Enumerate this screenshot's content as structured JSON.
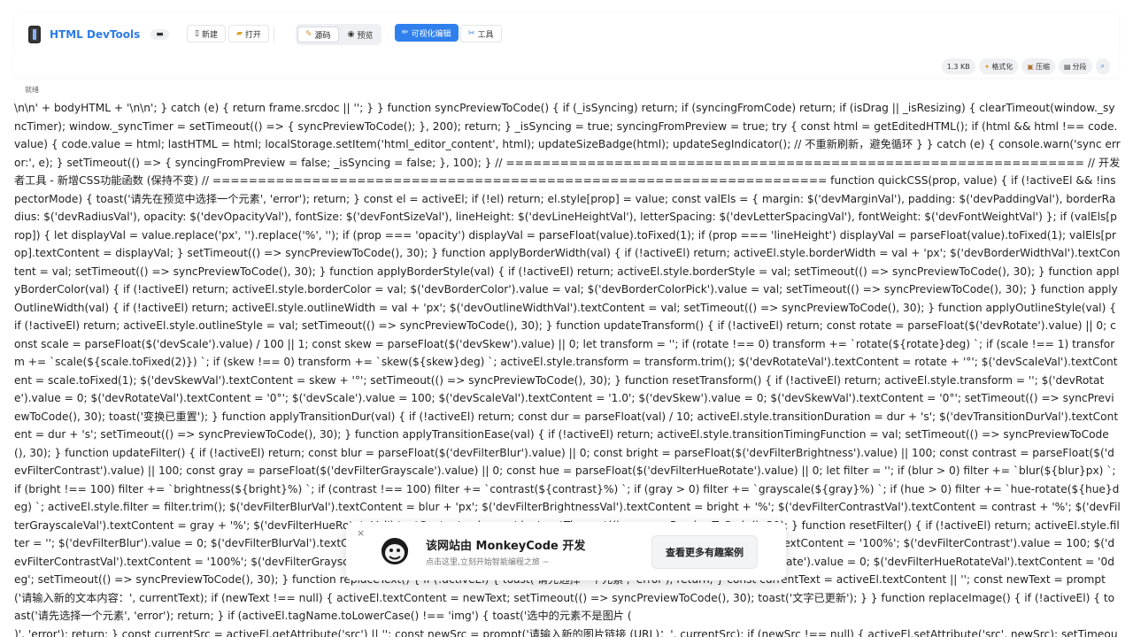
{
  "brand": {
    "title": "HTML DevTools",
    "badge": "▬"
  },
  "toolbar": {
    "new_label": "新建",
    "open_label": "打开",
    "source_label": "源码",
    "preview_label": "预览",
    "visual_edit_label": "可视化编辑",
    "tools_label": "工具"
  },
  "subbar": {
    "size_label": "1.3 KB",
    "format_label": "格式化",
    "compress_label": "压缩",
    "segment_label": "分段",
    "search_icon": "search-icon"
  },
  "status": {
    "text": "就绪"
  },
  "code": {
    "content": "\\n\\n' + bodyHTML + '\\n\\n'; } catch (e) { return frame.srcdoc || ''; } } function syncPreviewToCode() { if (_isSyncing) return; if (syncingFromCode) return; if (isDrag || _isResizing) { clearTimeout(window._syncTimer); window._syncTimer = setTimeout(() => { syncPreviewToCode(); }, 200); return; } _isSyncing = true; syncingFromPreview = true; try { const html = getEditedHTML(); if (html && html !== code.value) { code.value = html; lastHTML = html; localStorage.setItem('html_editor_content', html); updateSizeBadge(html); updateSegIndicator(); // 不重新刷新，避免循环 } } catch (e) { console.warn('sync error:', e); } setTimeout(() => { syncingFromPreview = false; _isSyncing = false; }, 100); } // ================================================================ // 开发者工具 - 新增CSS功能函数 (保持不变) // ==================================================================== function quickCSS(prop, value) { if (!activeEl && !inspectorMode) { toast('请先在预览中选择一个元素', 'error'); return; } const el = activeEl; if (!el) return; el.style[prop] = value; const valEls = { margin: $('devMarginVal'), padding: $('devPaddingVal'), borderRadius: $('devRadiusVal'), opacity: $('devOpacityVal'), fontSize: $('devFontSizeVal'), lineHeight: $('devLineHeightVal'), letterSpacing: $('devLetterSpacingVal'), fontWeight: $('devFontWeightVal') }; if (valEls[prop]) { let displayVal = value.replace('px', '').replace('%', ''); if (prop === 'opacity') displayVal = parseFloat(value).toFixed(1); if (prop === 'lineHeight') displayVal = parseFloat(value).toFixed(1); valEls[prop].textContent = displayVal; } setTimeout(() => syncPreviewToCode(), 30); } function applyBorderWidth(val) { if (!activeEl) return; activeEl.style.borderWidth = val + 'px'; $('devBorderWidthVal').textContent = val; setTimeout(() => syncPreviewToCode(), 30); } function applyBorderStyle(val) { if (!activeEl) return; activeEl.style.borderStyle = val; setTimeout(() => syncPreviewToCode(), 30); } function applyBorderColor(val) { if (!activeEl) return; activeEl.style.borderColor = val; $('devBorderColor').value = val; $('devBorderColorPick').value = val; setTimeout(() => syncPreviewToCode(), 30); } function applyOutlineWidth(val) { if (!activeEl) return; activeEl.style.outlineWidth = val + 'px'; $('devOutlineWidthVal').textContent = val; setTimeout(() => syncPreviewToCode(), 30); } function applyOutlineStyle(val) { if (!activeEl) return; activeEl.style.outlineStyle = val; setTimeout(() => syncPreviewToCode(), 30); } function updateTransform() { if (!activeEl) return; const rotate = parseFloat($('devRotate').value) || 0; const scale = parseFloat($('devScale').value) / 100 || 1; const skew = parseFloat($('devSkew').value) || 0; let transform = ''; if (rotate !== 0) transform += `rotate(${rotate}deg) `; if (scale !== 1) transform += `scale(${scale.toFixed(2)}) `; if (skew !== 0) transform += `skew(${skew}deg) `; activeEl.style.transform = transform.trim(); $('devRotateVal').textContent = rotate + '°'; $('devScaleVal').textContent = scale.toFixed(1); $('devSkewVal').textContent = skew + '°'; setTimeout(() => syncPreviewToCode(), 30); } function resetTransform() { if (!activeEl) return; activeEl.style.transform = ''; $('devRotate').value = 0; $('devRotateVal').textContent = '0°'; $('devScale').value = 100; $('devScaleVal').textContent = '1.0'; $('devSkew').value = 0; $('devSkewVal').textContent = '0°'; setTimeout(() => syncPreviewToCode(), 30); toast('变换已重置'); } function applyTransitionDur(val) { if (!activeEl) return; const dur = parseFloat(val) / 10; activeEl.style.transitionDuration = dur + 's'; $('devTransitionDurVal').textContent = dur + 's'; setTimeout(() => syncPreviewToCode(), 30); } function applyTransitionEase(val) { if (!activeEl) return; activeEl.style.transitionTimingFunction = val; setTimeout(() => syncPreviewToCode(), 30); } function updateFilter() { if (!activeEl) return; const blur = parseFloat($('devFilterBlur').value) || 0; const bright = parseFloat($('devFilterBrightness').value) || 100; const contrast = parseFloat($('devFilterContrast').value) || 100; const gray = parseFloat($('devFilterGrayscale').value) || 0; const hue = parseFloat($('devFilterHueRotate').value) || 0; let filter = ''; if (blur > 0) filter += `blur(${blur}px) `; if (bright !== 100) filter += `brightness(${bright}%) `; if (contrast !== 100) filter += `contrast(${contrast}%) `; if (gray > 0) filter += `grayscale(${gray}%) `; if (hue > 0) filter += `hue-rotate(${hue}deg) `; activeEl.style.filter = filter.trim(); $('devFilterBlurVal').textContent = blur + 'px'; $('devFilterBrightnessVal').textContent = bright + '%'; $('devFilterContrastVal').textContent = contrast + '%'; $('devFilterGrayscaleVal').textContent = gray + '%'; $('devFilterHueRotateVal').textContent = hue + 'deg'; setTimeout(() => syncPreviewToCode(), 30); } function resetFilter() { if (!activeEl) return; activeEl.style.filter = ''; $('devFilterBlur').value = 0; $('devFilterBlurVal').textContent = '0px'; $('devFilterBrightness').value = 100; $('devFilterBrightnessVal').textContent = '100%'; $('devFilterContrast').value = 100; $('devFilterContrastVal').textContent = '100%'; $('devFilterGrayscale').value = 0; $('devFilterGrayscaleVal').textContent = '0%'; $('devFilterHueRotate').value = 0; $('devFilterHueRotateVal').textContent = '0deg'; setTimeout(() => syncPreviewToCode(), 30); } function replaceText() { if (!activeEl) { toast('请先选择一个元素', 'error'); return; } const currentText = activeEl.textContent || ''; const newText = prompt('请输入新的文本内容：', currentText); if (newText !== null) { activeEl.textContent = newText; setTimeout(() => syncPreviewToCode(), 30); toast('文字已更新'); } } function replaceImage() { if (!activeEl) { toast('请先选择一个元素', 'error'); return; } if (activeEl.tagName.toLowerCase() !== 'img') { toast('选中的元素不是图片 (\n)', 'error'); return; } const currentSrc = activeEl.getAttribute('src') || ''; const newSrc = prompt('请输入新的图片链接 (URL)：', currentSrc); if (newSrc !== null) { activeEl.setAttribute('src', newSrc); setTimeout(() => syncPreviewToCode(), 30); toast('图片链接已更新'); } } function toggleInspector() { if (!editMode) toggleEdit(); inspectorMode = !inspectorMode; const btn = $('inspectorBtn'); if (inspectorMode) { btn.textContent = "
  },
  "toast": {
    "title": "该网站由 MonkeyCode 开发",
    "subtitle": "点击这里,立刻开始智能编程之旅 ~",
    "action_label": "查看更多有趣案例",
    "close_glyph": "×"
  }
}
